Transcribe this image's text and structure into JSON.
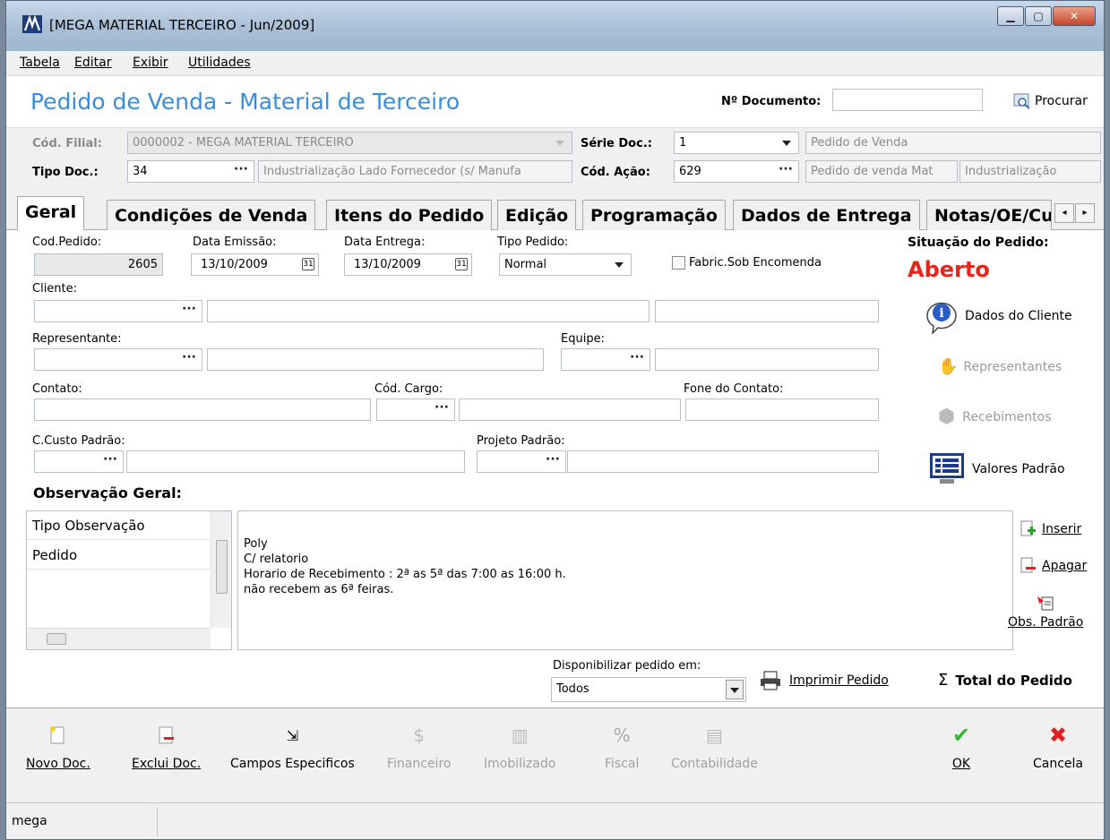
{
  "window": {
    "title": "[MEGA MATERIAL TERCEIRO - Jun/2009]"
  },
  "menu": [
    "Tabela",
    "Editar",
    "Exibir",
    "Utilidades"
  ],
  "header": {
    "page_title": "Pedido de Venda - Material de Terceiro",
    "doc_number_label": "Nº Documento:",
    "doc_number_value": "",
    "search_label": "Procurar"
  },
  "form_top": {
    "filial_label": "Cód. Filial:",
    "filial_value": "0000002 - MEGA MATERIAL TERCEIRO",
    "serie_label": "Série Doc.:",
    "serie_value": "1",
    "serie_desc": "Pedido de Venda",
    "tipo_doc_label": "Tipo Doc.:",
    "tipo_doc_code": "34",
    "tipo_doc_desc": "Industrialização Lado Fornecedor (s/ Manufa",
    "acao_label": "Cód. Ação:",
    "acao_code": "629",
    "acao_desc1": "Pedido de venda Mat",
    "acao_desc2": "Industrialização"
  },
  "tabs": [
    "Geral",
    "Condições de Venda",
    "Itens do Pedido",
    "Edição",
    "Programação",
    "Dados de Entrega",
    "Notas/OE/Cu"
  ],
  "geral": {
    "cod_pedido_label": "Cod.Pedido:",
    "cod_pedido_value": "2605",
    "data_emissao_label": "Data Emissão:",
    "data_emissao_value": "13/10/2009",
    "data_entrega_label": "Data Entrega:",
    "data_entrega_value": "13/10/2009",
    "tipo_pedido_label": "Tipo Pedido:",
    "tipo_pedido_value": "Normal",
    "fabric_label": "Fabric.Sob Encomenda",
    "cliente_label": "Cliente:",
    "representante_label": "Representante:",
    "equipe_label": "Equipe:",
    "contato_label": "Contato:",
    "cod_cargo_label": "Cód. Cargo:",
    "fone_label": "Fone do Contato:",
    "ccusto_label": "C.Custo Padrão:",
    "projeto_label": "Projeto Padrão:",
    "situacao_label": "Situação do Pedido:",
    "situacao_value": "Aberto",
    "situacao_color": "#e8251a"
  },
  "side_buttons": {
    "dados_cliente": "Dados do Cliente",
    "representantes": "Representantes",
    "recebimentos": "Recebimentos",
    "valores_padrao": "Valores Padrão"
  },
  "observacao": {
    "title": "Observação Geral:",
    "list_header": "Tipo Observação",
    "list_items": [
      "Pedido"
    ],
    "text_lines": [
      "Poly",
      "C/ relatorio",
      "Horario de Recebimento : 2ª as 5ª das 7:00 as 16:00 h.",
      "não recebem as 6ª feiras."
    ],
    "inserir": "Inserir",
    "apagar": "Apagar",
    "obs_padrao": "Obs. Padrão"
  },
  "bottom_panel": {
    "disponibilizar_label": "Disponibilizar pedido em:",
    "disponibilizar_value": "Todos",
    "imprimir": "Imprimir Pedido",
    "total": "Total do Pedido"
  },
  "toolbar": {
    "novo": "Novo Doc.",
    "exclui": "Exclui Doc.",
    "campos": "Campos Especificos",
    "financeiro": "Financeiro",
    "imobilizado": "Imobilizado",
    "fiscal": "Fiscal",
    "contabilidade": "Contabilidade",
    "ok": "OK",
    "cancela": "Cancela"
  },
  "status": {
    "user": "mega"
  },
  "icons": {
    "app": "mega-logo-icon",
    "search": "magnifier-icon",
    "info": "info-icon",
    "representantes": "handshake-icon",
    "recebimentos": "payment-icon",
    "valores": "monitor-list-icon",
    "inserir": "add-doc-icon",
    "apagar": "remove-doc-icon",
    "obs": "doc-arrow-icon",
    "print": "printer-icon",
    "sigma": "sigma-icon",
    "ok": "check-icon",
    "cancel": "x-icon"
  }
}
